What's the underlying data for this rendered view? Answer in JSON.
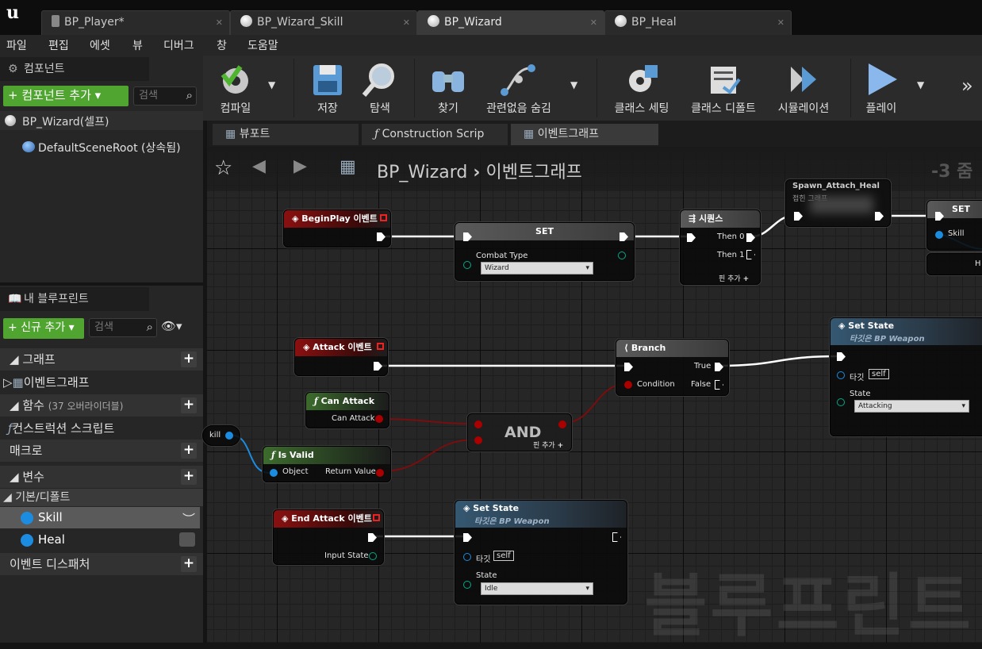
{
  "tabs": [
    "BP_Player*",
    "BP_Wizard_Skill",
    "BP_Wizard",
    "BP_Heal"
  ],
  "menu": [
    "파일",
    "편집",
    "에셋",
    "뷰",
    "디버그",
    "창",
    "도움말"
  ],
  "components": {
    "title": "컴포넌트",
    "add_button": "+ 컴포넌트 추가 ▾",
    "search_placeholder": "검색",
    "self_item": "BP_Wizard(셀프)",
    "root_item": "DefaultSceneRoot (상속됨)"
  },
  "myblueprint": {
    "title": "내 블루프린트",
    "add_button": "+ 신규 추가 ▾",
    "search_placeholder": "검색",
    "sections": {
      "graphs": "그래프",
      "eventgraph": "이벤트그래프",
      "functions": "함수",
      "functions_note": "(37 오버라이더블)",
      "construction": "컨스트럭션 스크립트",
      "macros": "매크로",
      "variables": "변수",
      "category": "기본/디폴트",
      "var_skill": "Skill",
      "var_heal": "Heal",
      "dispatchers": "이벤트 디스패처"
    }
  },
  "toolbar": {
    "compile": "컴파일",
    "save": "저장",
    "browse": "탐색",
    "find": "찾기",
    "hide": "관련없음 숨김",
    "class_settings": "클래스 세팅",
    "class_defaults": "클래스 디폴트",
    "simulation": "시뮬레이션",
    "play": "플레이"
  },
  "graph_tabs": [
    "뷰포트",
    "Construction Scrip",
    "이벤트그래프"
  ],
  "breadcrumb": {
    "bp": "BP_Wizard",
    "graph": "이벤트그래프",
    "zoom": "-3 줌"
  },
  "nodes": {
    "beginplay": "BeginPlay 이벤트",
    "set1": {
      "title": "SET",
      "pin": "Combat Type",
      "value": "Wizard"
    },
    "sequence": {
      "title": "시퀀스",
      "then0": "Then 0",
      "then1": "Then 1",
      "add": "핀 추가"
    },
    "spawn": {
      "title": "Spawn_Attach_Heal",
      "sub": "접힌 그래프"
    },
    "set2": {
      "title": "SET",
      "pin": "Skill",
      "h": "H"
    },
    "attack": "Attack 이벤트",
    "branch": {
      "title": "Branch",
      "true": "True",
      "false": "False",
      "condition": "Condition"
    },
    "setstate1": {
      "title": "Set State",
      "sub": "타깃은 BP Weapon",
      "target": "타깃",
      "self": "self",
      "state": "State",
      "value": "Attacking"
    },
    "canattack": {
      "title": "Can Attack",
      "out": "Can Attack"
    },
    "and": {
      "title": "AND",
      "add": "핀 추가"
    },
    "skillvar": "kill",
    "isvalid": {
      "title": "Is Valid",
      "object": "Object",
      "ret": "Return Value"
    },
    "endattack": {
      "title": "End Attack 이벤트",
      "input": "Input State"
    },
    "setstate2": {
      "title": "Set State",
      "sub": "타깃은 BP Weapon",
      "target": "타깃",
      "self": "self",
      "state": "State",
      "value": "Idle"
    }
  },
  "watermark": "블루프린트"
}
